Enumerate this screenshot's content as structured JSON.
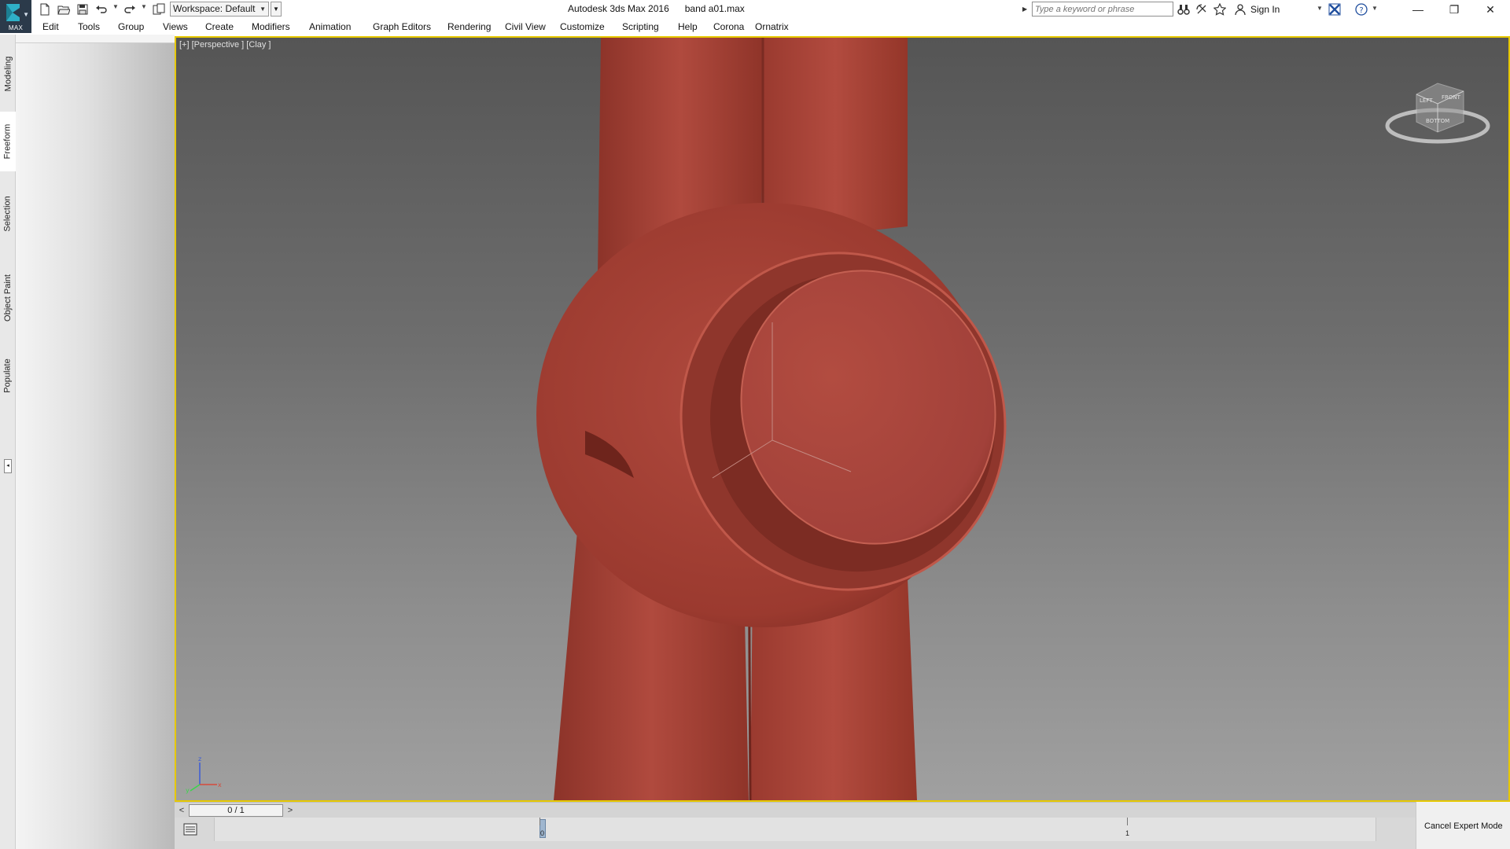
{
  "app": {
    "logo_caption": "MAX",
    "window_title": "Autodesk 3ds Max 2016      band a01.max"
  },
  "quick_access": {
    "workspace_label": "Workspace: Default",
    "icons": [
      "new-file-icon",
      "open-folder-icon",
      "save-icon",
      "undo-icon",
      "redo-icon",
      "project-folder-icon"
    ]
  },
  "search": {
    "placeholder": "Type a keyword or phrase"
  },
  "account": {
    "sign_in_label": "Sign In"
  },
  "menu": {
    "items": [
      "Edit",
      "Tools",
      "Group",
      "Views",
      "Create",
      "Modifiers",
      "Animation",
      "Graph Editors",
      "Rendering",
      "Civil View",
      "Customize",
      "Scripting",
      "Help",
      "Corona",
      "Ornatrix"
    ]
  },
  "ribbon": {
    "tabs": [
      "Modeling",
      "Freeform",
      "Selection",
      "Object Paint",
      "Populate"
    ],
    "active_tab": "Freeform"
  },
  "viewport": {
    "label": "[+] [Perspective ] [Clay ]",
    "active_border_color": "#e6c800",
    "object_color": "#a8443a",
    "viewcube_faces": [
      "LEFT",
      "FRONT",
      "BOTTOM"
    ],
    "axes": [
      "x",
      "y",
      "z"
    ]
  },
  "timeline": {
    "frame_display": "0 / 1",
    "prev_label": "<",
    "next_label": ">",
    "tick_start": "0",
    "tick_end": "1"
  },
  "status": {
    "cancel_expert_label": "Cancel Expert Mode"
  }
}
